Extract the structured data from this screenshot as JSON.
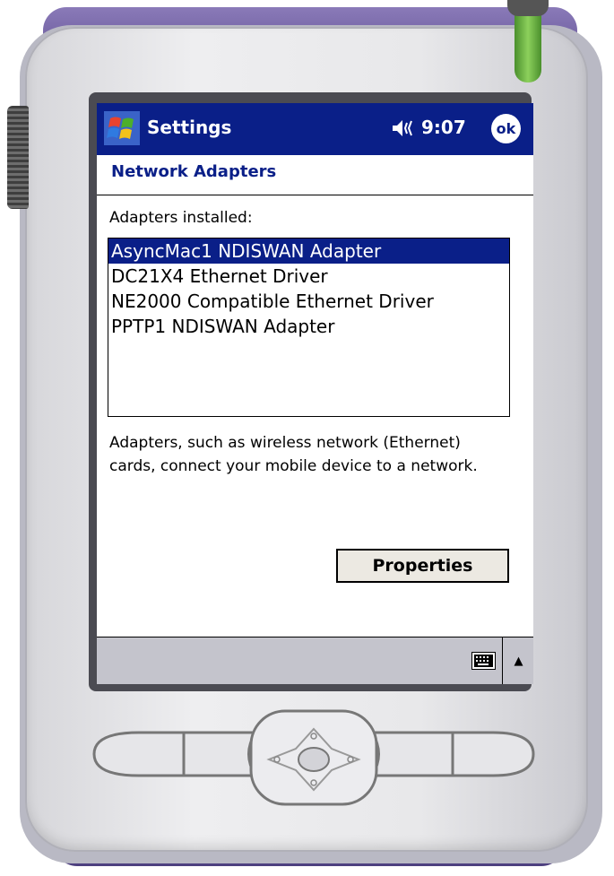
{
  "titlebar": {
    "app_title": "Settings",
    "time": "9:07",
    "ok_label": "ok",
    "bg_color": "#0a1f88"
  },
  "page": {
    "heading": "Network Adapters",
    "list_label": "Adapters installed:",
    "adapters": [
      "AsyncMac1 NDISWAN Adapter",
      "DC21X4 Ethernet Driver",
      "NE2000 Compatible Ethernet Driver",
      "PPTP1 NDISWAN Adapter"
    ],
    "selected_index": 0,
    "description": "Adapters, such as wireless network (Ethernet) cards, connect your mobile device to a network.",
    "properties_label": "Properties"
  },
  "menubar": {
    "sip_arrow": "▲"
  },
  "icons": {
    "start": "windows-flag-icon",
    "volume": "speaker-icon",
    "keyboard": "keyboard-icon"
  }
}
